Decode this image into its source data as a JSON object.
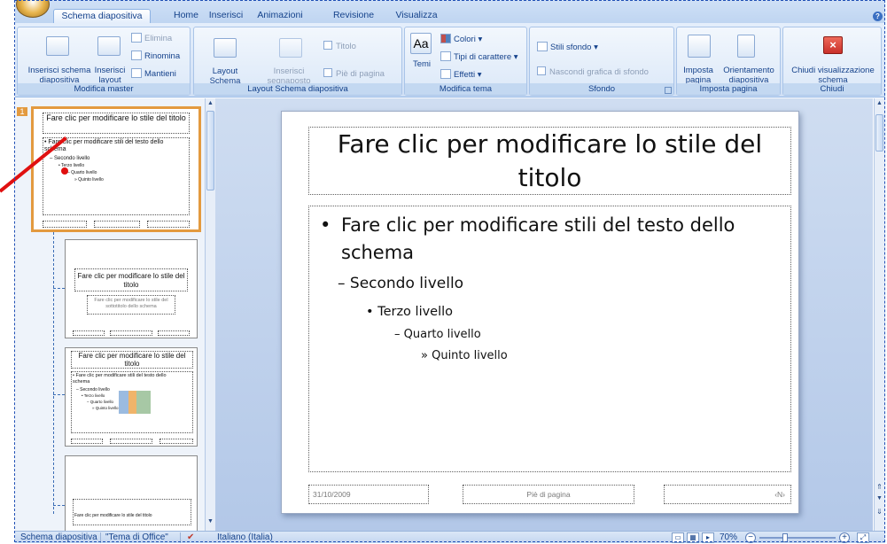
{
  "tabs": [
    "Schema diapositiva",
    "Home",
    "Inserisci",
    "Animazioni",
    "Revisione",
    "Visualizza"
  ],
  "help": "?",
  "groups": {
    "modifica_master": {
      "label": "Modifica master",
      "inserisci_schema": "Inserisci schema diapositiva",
      "inserisci_layout": "Inserisci layout",
      "elimina": "Elimina",
      "rinomina": "Rinomina",
      "mantieni": "Mantieni"
    },
    "layout": {
      "label": "Layout Schema diapositiva",
      "layout_schema": "Layout Schema diapositiva",
      "inserisci_segnaposto": "Inserisci segnaposto",
      "titolo": "Titolo",
      "pie_di_pagina": "Piè di pagina"
    },
    "tema": {
      "label": "Modifica tema",
      "temi": "Temi",
      "colori": "Colori",
      "tipi_carattere": "Tipi di carattere",
      "effetti": "Effetti"
    },
    "sfondo": {
      "label": "Sfondo",
      "stili_sfondo": "Stili sfondo",
      "nascondi": "Nascondi grafica di sfondo"
    },
    "imposta": {
      "label": "Imposta pagina",
      "imposta_pagina": "Imposta pagina",
      "orientamento": "Orientamento diapositiva"
    },
    "chiudi": {
      "label": "Chiudi",
      "chiudi_btn": "Chiudi visualizzazione schema"
    }
  },
  "thumbs": {
    "t1": {
      "num": "1",
      "title": "Fare clic per modificare lo stile del titolo",
      "body": "• Fare clic per modificare stili del testo dello schema",
      "l2": "– Secondo livello",
      "l3": "• Terzo livello",
      "l4": "– Quarto livello",
      "l5": "» Quinto livello"
    },
    "t2": {
      "title": "Fare clic per modificare lo stile del titolo",
      "sub": "Fare clic per modificare lo stile del sottotitolo dello schema"
    },
    "t3": {
      "title": "Fare clic per modificare lo stile del titolo",
      "body": "• Fare clic per modificare stili del testo dello schema",
      "l2": "– Secondo livello",
      "l3": "• Terzo livello",
      "l4": "– Quarto livello",
      "l5": "» Quinto livello"
    },
    "t4": {
      "text": "Fare clic per modificare lo stile del titolo"
    }
  },
  "slide": {
    "title": "Fare clic per modificare lo stile del titolo",
    "body": "Fare clic per modificare stili del testo dello schema",
    "l2": "Secondo livello",
    "l3": "Terzo livello",
    "l4": "Quarto livello",
    "l5": "Quinto livello",
    "date": "31/10/2009",
    "footer": "Piè di pagina",
    "number": "‹N›"
  },
  "status": {
    "mode": "Schema diapositiva",
    "theme": "\"Tema di Office\"",
    "language": "Italiano (Italia)",
    "zoom": "70%"
  },
  "colors": {
    "accent": "#e39a3f",
    "ribbon": "#dbe8f8",
    "arrow": "#e01010"
  }
}
